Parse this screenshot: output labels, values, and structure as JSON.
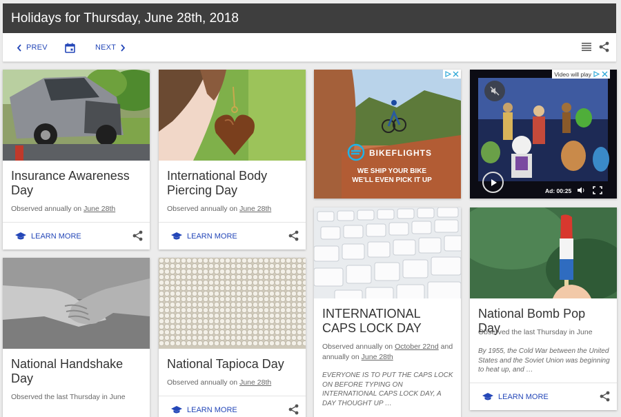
{
  "header": {
    "title": "Holidays for Thursday, June 28th, 2018"
  },
  "toolbar": {
    "prev_label": "PREV",
    "next_label": "NEXT"
  },
  "icons": [
    "chevron-left-icon",
    "calendar-icon",
    "chevron-right-icon",
    "list-icon",
    "share-icon",
    "graduation-cap-icon",
    "play-icon",
    "mute-icon",
    "fullscreen-icon",
    "adchoices-icon",
    "close-icon"
  ],
  "colors": {
    "header_bg": "#3e3e3e",
    "accent": "#2447b8",
    "page_bg": "#ececec",
    "card_bg": "#ffffff"
  },
  "cards": [
    {
      "title": "Insurance Awareness Day",
      "observed_prefix": "Observed annually on ",
      "observed_date": "June 28th",
      "learn_more": "LEARN MORE"
    },
    {
      "title": "International Body Piercing Day",
      "observed_prefix": "Observed annually on ",
      "observed_date": "June 28th",
      "learn_more": "LEARN MORE"
    },
    {
      "title": "National Handshake Day",
      "observed": "Observed the last Thursday in June"
    },
    {
      "title": "National Tapioca Day",
      "observed_prefix": "Observed annually on ",
      "observed_date": "June 28th",
      "learn_more": "LEARN MORE"
    },
    {
      "title": "INTERNATIONAL CAPS LOCK DAY",
      "observed_prefix": "Observed annually on ",
      "observed_date": "October 22nd",
      "observed_mid": " and annually on ",
      "observed_date2": "June 28th",
      "description": "EVERYONE IS TO PUT THE CAPS LOCK ON BEFORE TYPING ON INTERNATIONAL CAPS LOCK DAY, A DAY THOUGHT UP …"
    },
    {
      "title": "National Bomb Pop Day",
      "observed": "Observed the last Thursday in June",
      "description": "By 1955, the Cold War between the United States and the Soviet Union was beginning to heat up, and …",
      "learn_more": "LEARN MORE"
    }
  ],
  "ads": {
    "bikeflights": {
      "brand": "BIKEFLIGHTS",
      "line1": "WE SHIP YOUR BIKE",
      "line2": "WE'LL EVEN PICK IT UP"
    },
    "video": {
      "banner": "Video will play",
      "timer": "Ad: 00:25"
    }
  }
}
